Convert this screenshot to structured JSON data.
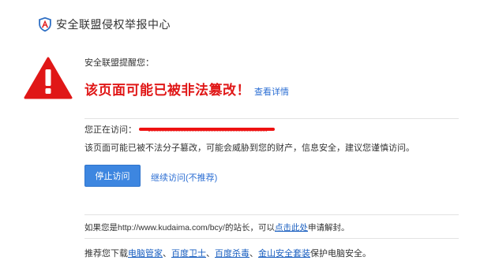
{
  "header": {
    "brand": "安全联盟侵权举报中心",
    "icon": "shield-icon"
  },
  "warning": {
    "icon": "warning-triangle-icon",
    "icon_color": "#e01717",
    "reminder": "安全联盟提醒您：",
    "headline": "该页面可能已被非法篡改！",
    "details_link": "查看详情"
  },
  "visit": {
    "label": "您正在访问：",
    "url_redacted": true
  },
  "risk_text": "该页面可能已被不法分子篡改，可能会威胁到您的财产，信息安全，建议您谨慎访问。",
  "actions": {
    "stop_label": "停止访问",
    "continue_label": "继续访问(不推荐)"
  },
  "owner": {
    "prefix": "如果您是http://www.kudaima.com/bcy/的站长，可以",
    "link": "点击此处",
    "suffix": "申请解封。"
  },
  "recommend": {
    "prefix": "推荐您下载",
    "items": [
      "电脑管家",
      "百度卫士",
      "百度杀毒",
      "金山安全套装"
    ],
    "separator": "、",
    "suffix": "保护电脑安全。"
  },
  "colors": {
    "accent_red": "#e01717",
    "link_blue": "#2b6ed3",
    "button_blue": "#3d86e0"
  }
}
